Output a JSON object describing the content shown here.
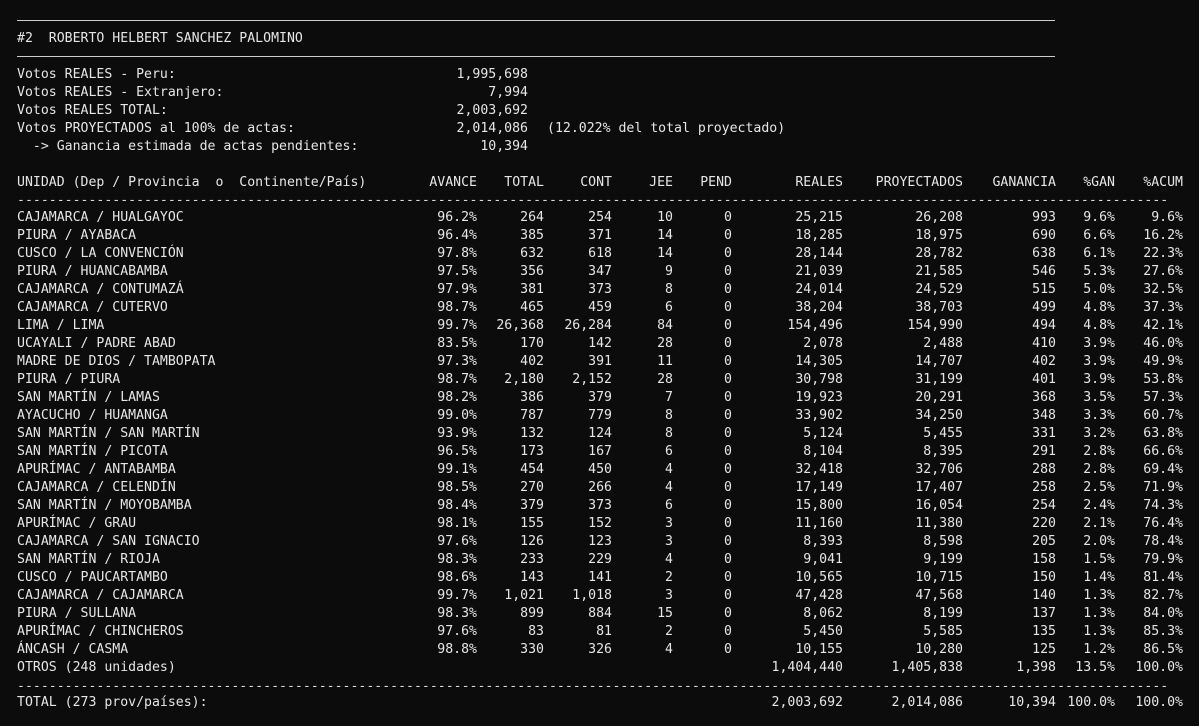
{
  "header": {
    "candidate": "#2  ROBERTO HELBERT SANCHEZ PALOMINO"
  },
  "summary": [
    {
      "label": "Votos REALES - Peru:",
      "value": "1,995,698",
      "note": ""
    },
    {
      "label": "Votos REALES - Extranjero:",
      "value": "7,994",
      "note": ""
    },
    {
      "label": "Votos REALES TOTAL:",
      "value": "2,003,692",
      "note": ""
    },
    {
      "label": "Votos PROYECTADOS al 100% de actas:",
      "value": "2,014,086",
      "note": "(12.022% del total proyectado)"
    },
    {
      "label": "  -> Ganancia estimada de actas pendientes:",
      "value": "10,394",
      "note": ""
    }
  ],
  "table": {
    "columns": [
      "UNIDAD (Dep / Provincia  o  Continente/País)",
      "AVANCE",
      "TOTAL",
      "CONT",
      "JEE",
      "PEND",
      "REALES",
      "PROYECTADOS",
      "GANANCIA",
      "%GAN",
      "%ACUM"
    ],
    "rows": [
      [
        "CAJAMARCA / HUALGAYOC",
        "96.2%",
        "264",
        "254",
        "10",
        "0",
        "25,215",
        "26,208",
        "993",
        "9.6%",
        "9.6%"
      ],
      [
        "PIURA / AYABACA",
        "96.4%",
        "385",
        "371",
        "14",
        "0",
        "18,285",
        "18,975",
        "690",
        "6.6%",
        "16.2%"
      ],
      [
        "CUSCO / LA CONVENCIÓN",
        "97.8%",
        "632",
        "618",
        "14",
        "0",
        "28,144",
        "28,782",
        "638",
        "6.1%",
        "22.3%"
      ],
      [
        "PIURA / HUANCABAMBA",
        "97.5%",
        "356",
        "347",
        "9",
        "0",
        "21,039",
        "21,585",
        "546",
        "5.3%",
        "27.6%"
      ],
      [
        "CAJAMARCA / CONTUMAZÁ",
        "97.9%",
        "381",
        "373",
        "8",
        "0",
        "24,014",
        "24,529",
        "515",
        "5.0%",
        "32.5%"
      ],
      [
        "CAJAMARCA / CUTERVO",
        "98.7%",
        "465",
        "459",
        "6",
        "0",
        "38,204",
        "38,703",
        "499",
        "4.8%",
        "37.3%"
      ],
      [
        "LIMA / LIMA",
        "99.7%",
        "26,368",
        "26,284",
        "84",
        "0",
        "154,496",
        "154,990",
        "494",
        "4.8%",
        "42.1%"
      ],
      [
        "UCAYALI / PADRE ABAD",
        "83.5%",
        "170",
        "142",
        "28",
        "0",
        "2,078",
        "2,488",
        "410",
        "3.9%",
        "46.0%"
      ],
      [
        "MADRE DE DIOS / TAMBOPATA",
        "97.3%",
        "402",
        "391",
        "11",
        "0",
        "14,305",
        "14,707",
        "402",
        "3.9%",
        "49.9%"
      ],
      [
        "PIURA / PIURA",
        "98.7%",
        "2,180",
        "2,152",
        "28",
        "0",
        "30,798",
        "31,199",
        "401",
        "3.9%",
        "53.8%"
      ],
      [
        "SAN MARTÍN / LAMAS",
        "98.2%",
        "386",
        "379",
        "7",
        "0",
        "19,923",
        "20,291",
        "368",
        "3.5%",
        "57.3%"
      ],
      [
        "AYACUCHO / HUAMANGA",
        "99.0%",
        "787",
        "779",
        "8",
        "0",
        "33,902",
        "34,250",
        "348",
        "3.3%",
        "60.7%"
      ],
      [
        "SAN MARTÍN / SAN MARTÍN",
        "93.9%",
        "132",
        "124",
        "8",
        "0",
        "5,124",
        "5,455",
        "331",
        "3.2%",
        "63.8%"
      ],
      [
        "SAN MARTÍN / PICOTA",
        "96.5%",
        "173",
        "167",
        "6",
        "0",
        "8,104",
        "8,395",
        "291",
        "2.8%",
        "66.6%"
      ],
      [
        "APURÍMAC / ANTABAMBA",
        "99.1%",
        "454",
        "450",
        "4",
        "0",
        "32,418",
        "32,706",
        "288",
        "2.8%",
        "69.4%"
      ],
      [
        "CAJAMARCA / CELENDÍN",
        "98.5%",
        "270",
        "266",
        "4",
        "0",
        "17,149",
        "17,407",
        "258",
        "2.5%",
        "71.9%"
      ],
      [
        "SAN MARTÍN / MOYOBAMBA",
        "98.4%",
        "379",
        "373",
        "6",
        "0",
        "15,800",
        "16,054",
        "254",
        "2.4%",
        "74.3%"
      ],
      [
        "APURÍMAC / GRAU",
        "98.1%",
        "155",
        "152",
        "3",
        "0",
        "11,160",
        "11,380",
        "220",
        "2.1%",
        "76.4%"
      ],
      [
        "CAJAMARCA / SAN IGNACIO",
        "97.6%",
        "126",
        "123",
        "3",
        "0",
        "8,393",
        "8,598",
        "205",
        "2.0%",
        "78.4%"
      ],
      [
        "SAN MARTÍN / RIOJA",
        "98.3%",
        "233",
        "229",
        "4",
        "0",
        "9,041",
        "9,199",
        "158",
        "1.5%",
        "79.9%"
      ],
      [
        "CUSCO / PAUCARTAMBO",
        "98.6%",
        "143",
        "141",
        "2",
        "0",
        "10,565",
        "10,715",
        "150",
        "1.4%",
        "81.4%"
      ],
      [
        "CAJAMARCA / CAJAMARCA",
        "99.7%",
        "1,021",
        "1,018",
        "3",
        "0",
        "47,428",
        "47,568",
        "140",
        "1.3%",
        "82.7%"
      ],
      [
        "PIURA / SULLANA",
        "98.3%",
        "899",
        "884",
        "15",
        "0",
        "8,062",
        "8,199",
        "137",
        "1.3%",
        "84.0%"
      ],
      [
        "APURÍMAC / CHINCHEROS",
        "97.6%",
        "83",
        "81",
        "2",
        "0",
        "5,450",
        "5,585",
        "135",
        "1.3%",
        "85.3%"
      ],
      [
        "ÁNCASH / CASMA",
        "98.8%",
        "330",
        "326",
        "4",
        "0",
        "10,155",
        "10,280",
        "125",
        "1.2%",
        "86.5%"
      ],
      [
        "OTROS (248 unidades)",
        "",
        "",
        "",
        "",
        "",
        "1,404,440",
        "1,405,838",
        "1,398",
        "13.5%",
        "100.0%"
      ]
    ],
    "total": [
      "TOTAL (273 prov/países):",
      "",
      "",
      "",
      "",
      "",
      "2,003,692",
      "2,014,086",
      "10,394",
      "100.0%",
      "100.0%"
    ]
  }
}
